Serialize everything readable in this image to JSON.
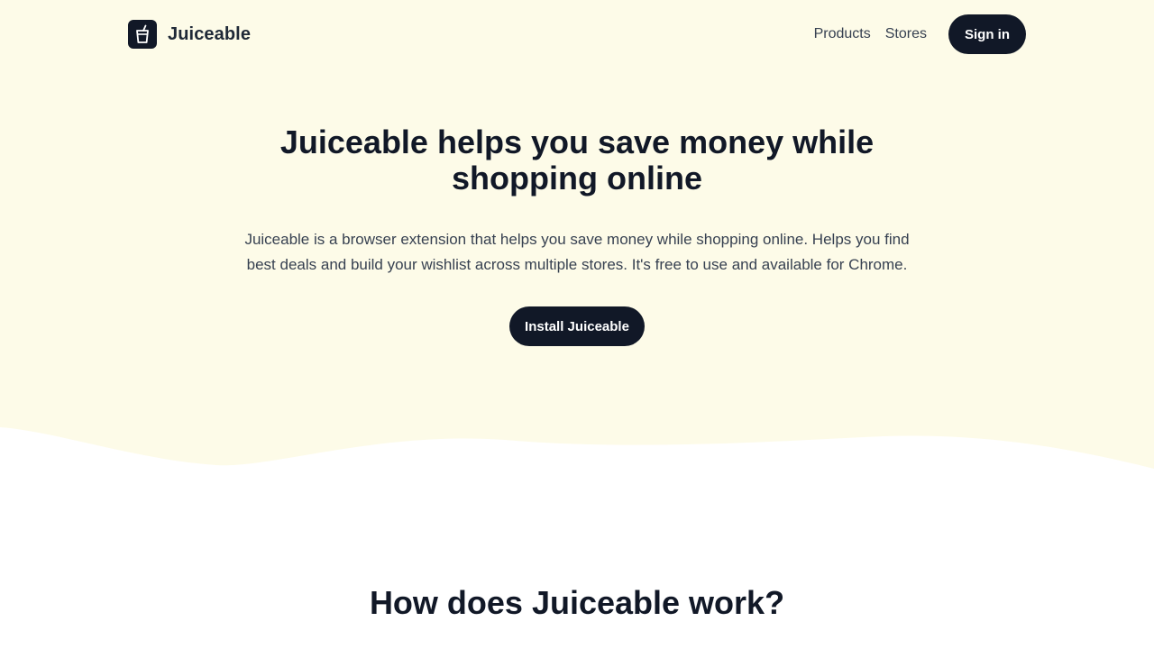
{
  "colors": {
    "hero_background": "#fdfbe8",
    "page_background": "#ffffff",
    "primary_dark": "#111827",
    "text_body": "#374151"
  },
  "brand": {
    "name": "Juiceable",
    "logo_icon": "juice-cup-icon"
  },
  "nav": {
    "links": [
      {
        "label": "Products"
      },
      {
        "label": "Stores"
      }
    ],
    "signin_label": "Sign in"
  },
  "hero": {
    "title": "Juiceable helps you save money while shopping online",
    "description": "Juiceable is a browser extension that helps you save money while shopping online. Helps you find best deals and build your wishlist across multiple stores. It's free to use and available for Chrome.",
    "cta_label": "Install Juiceable"
  },
  "how_it_works": {
    "title": "How does Juiceable work?"
  }
}
